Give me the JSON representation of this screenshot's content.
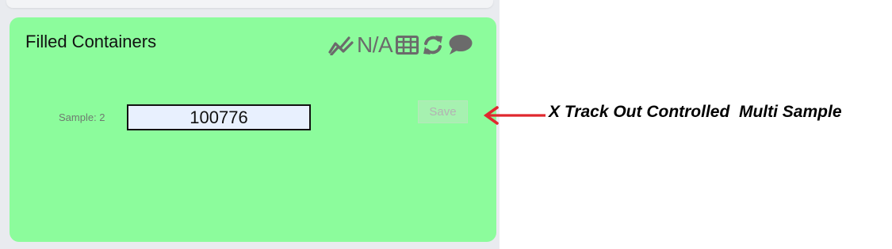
{
  "card": {
    "title": "Filled Containers",
    "background": "#8cfc9c"
  },
  "toolbar": {
    "icons": [
      "trend-chart-icon",
      "table-icon",
      "refresh-icon",
      "comment-icon"
    ],
    "na_label": "N/A"
  },
  "sample": {
    "label": "Sample: 2",
    "value": "100776"
  },
  "save_button": {
    "label": "Save",
    "disabled": true
  },
  "annotation": {
    "text": "X Track Out Controlled  Multi Sample",
    "arrow_color": "#e0282e"
  }
}
